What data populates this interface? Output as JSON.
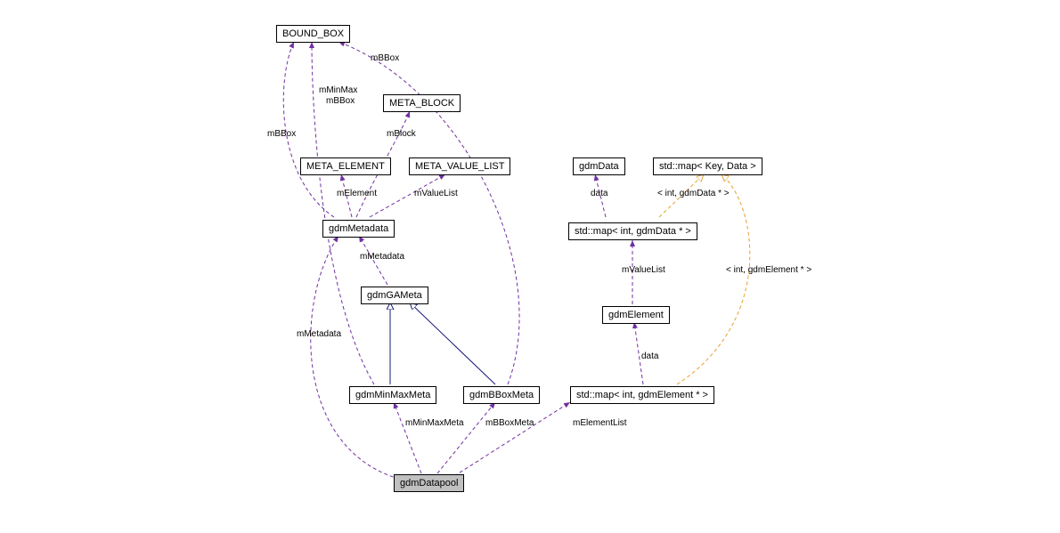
{
  "nodes": {
    "bound_box": "BOUND_BOX",
    "meta_block": "META_BLOCK",
    "meta_element": "META_ELEMENT",
    "meta_value_list": "META_VALUE_LIST",
    "gdmdata": "gdmData",
    "std_map_key": "std::map< Key, Data >",
    "gdmmetadata": "gdmMetadata",
    "std_map_int_data": "std::map< int, gdmData * >",
    "gdmgameta": "gdmGAMeta",
    "gdmelement": "gdmElement",
    "gdmminmaxmeta": "gdmMinMaxMeta",
    "gdmbboxmeta": "gdmBBoxMeta",
    "std_map_int_elem": "std::map< int, gdmElement * >",
    "gdmdatapool": "gdmDatapool"
  },
  "edges": {
    "mbbox1": "mBBox",
    "mbbox2": "mBBox",
    "mbbox3": "mBBox",
    "mminmax": "mMinMax",
    "mblock": "mBlock",
    "melement": "mElement",
    "mvaluelist": "mValueList",
    "data1": "data",
    "int_gdmdata": "< int, gdmData * >",
    "mmetadata1": "mMetadata",
    "mvaluelist2": "mValueList",
    "int_gdmelement": "< int, gdmElement * >",
    "mmetadata2": "mMetadata",
    "data2": "data",
    "mminmaxmeta": "mMinMaxMeta",
    "mbboxmeta": "mBBoxMeta",
    "melementlist": "mElementList"
  }
}
